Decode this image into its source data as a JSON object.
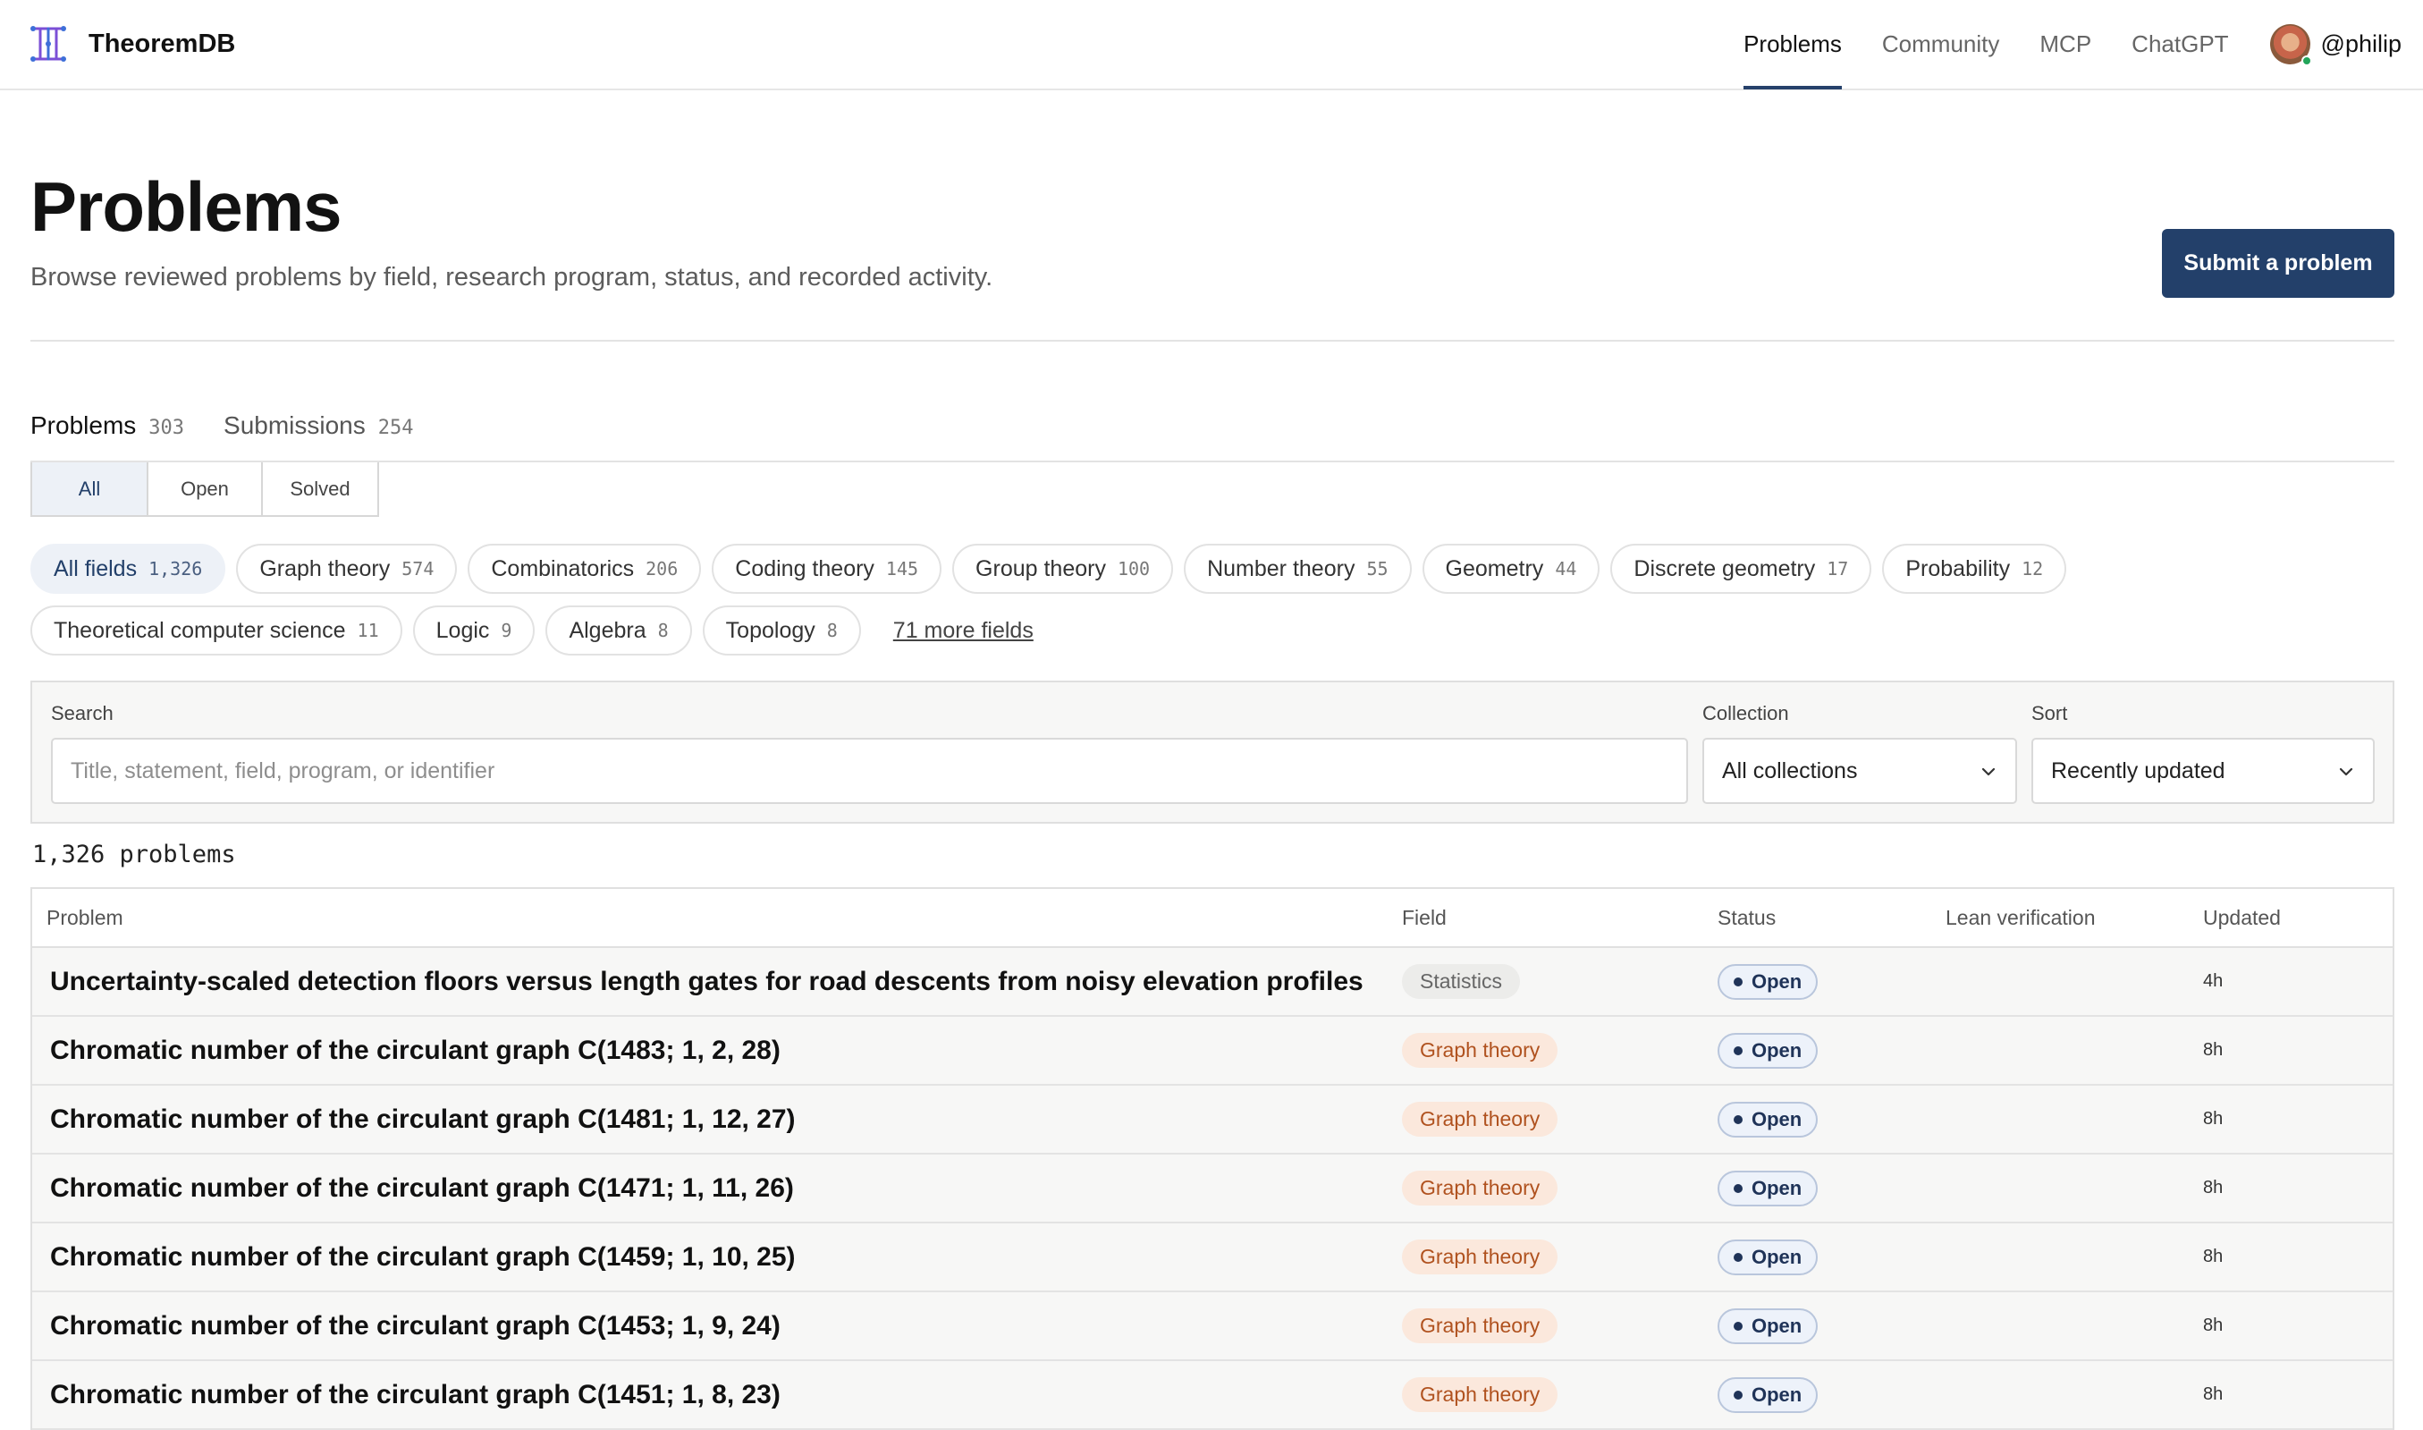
{
  "brand": {
    "name": "TheoremDB",
    "logo_icon": "theorem-logo-icon"
  },
  "nav": {
    "items": [
      {
        "label": "Problems",
        "active": true
      },
      {
        "label": "Community",
        "active": false
      },
      {
        "label": "MCP",
        "active": false
      },
      {
        "label": "ChatGPT",
        "active": false
      }
    ],
    "user": "@philip"
  },
  "header": {
    "title": "Problems",
    "subtitle": "Browse reviewed problems by field, research program, status, and recorded activity.",
    "submit_label": "Submit a problem"
  },
  "tabs": [
    {
      "label": "Problems",
      "count": "303",
      "active": true
    },
    {
      "label": "Submissions",
      "count": "254",
      "active": false
    }
  ],
  "status_filter": [
    {
      "label": "All",
      "active": true
    },
    {
      "label": "Open",
      "active": false
    },
    {
      "label": "Solved",
      "active": false
    }
  ],
  "fields": {
    "row1": [
      {
        "label": "All fields",
        "count": "1,326",
        "active": true
      },
      {
        "label": "Graph theory",
        "count": "574"
      },
      {
        "label": "Combinatorics",
        "count": "206"
      },
      {
        "label": "Coding theory",
        "count": "145"
      },
      {
        "label": "Group theory",
        "count": "100"
      },
      {
        "label": "Number theory",
        "count": "55"
      },
      {
        "label": "Geometry",
        "count": "44"
      },
      {
        "label": "Discrete geometry",
        "count": "17"
      },
      {
        "label": "Probability",
        "count": "12"
      }
    ],
    "row2": [
      {
        "label": "Theoretical computer science",
        "count": "11"
      },
      {
        "label": "Logic",
        "count": "9"
      },
      {
        "label": "Algebra",
        "count": "8"
      },
      {
        "label": "Topology",
        "count": "8"
      }
    ],
    "more": "71 more fields"
  },
  "filters": {
    "search_label": "Search",
    "search_placeholder": "Title, statement, field, program, or identifier",
    "collection_label": "Collection",
    "collection_value": "All collections",
    "sort_label": "Sort",
    "sort_value": "Recently updated"
  },
  "result_count": "1,326 problems",
  "table": {
    "headers": {
      "problem": "Problem",
      "field": "Field",
      "status": "Status",
      "lean": "Lean verification",
      "updated": "Updated"
    },
    "rows": [
      {
        "title": "Uncertainty-scaled detection floors versus length gates for road descents from noisy elevation profiles",
        "field": "Statistics",
        "field_style": "neutral",
        "status": "Open",
        "lean": "",
        "updated": "4h"
      },
      {
        "title": "Chromatic number of the circulant graph C(1483; 1, 2, 28)",
        "field": "Graph theory",
        "field_style": "graph",
        "status": "Open",
        "lean": "",
        "updated": "8h"
      },
      {
        "title": "Chromatic number of the circulant graph C(1481; 1, 12, 27)",
        "field": "Graph theory",
        "field_style": "graph",
        "status": "Open",
        "lean": "",
        "updated": "8h"
      },
      {
        "title": "Chromatic number of the circulant graph C(1471; 1, 11, 26)",
        "field": "Graph theory",
        "field_style": "graph",
        "status": "Open",
        "lean": "",
        "updated": "8h"
      },
      {
        "title": "Chromatic number of the circulant graph C(1459; 1, 10, 25)",
        "field": "Graph theory",
        "field_style": "graph",
        "status": "Open",
        "lean": "",
        "updated": "8h"
      },
      {
        "title": "Chromatic number of the circulant graph C(1453; 1, 9, 24)",
        "field": "Graph theory",
        "field_style": "graph",
        "status": "Open",
        "lean": "",
        "updated": "8h"
      },
      {
        "title": "Chromatic number of the circulant graph C(1451; 1, 8, 23)",
        "field": "Graph theory",
        "field_style": "graph",
        "status": "Open",
        "lean": "",
        "updated": "8h"
      }
    ]
  },
  "colors": {
    "accent": "#23406a",
    "graph_badge_bg": "#fbe8dc",
    "graph_badge_text": "#b0521f"
  }
}
